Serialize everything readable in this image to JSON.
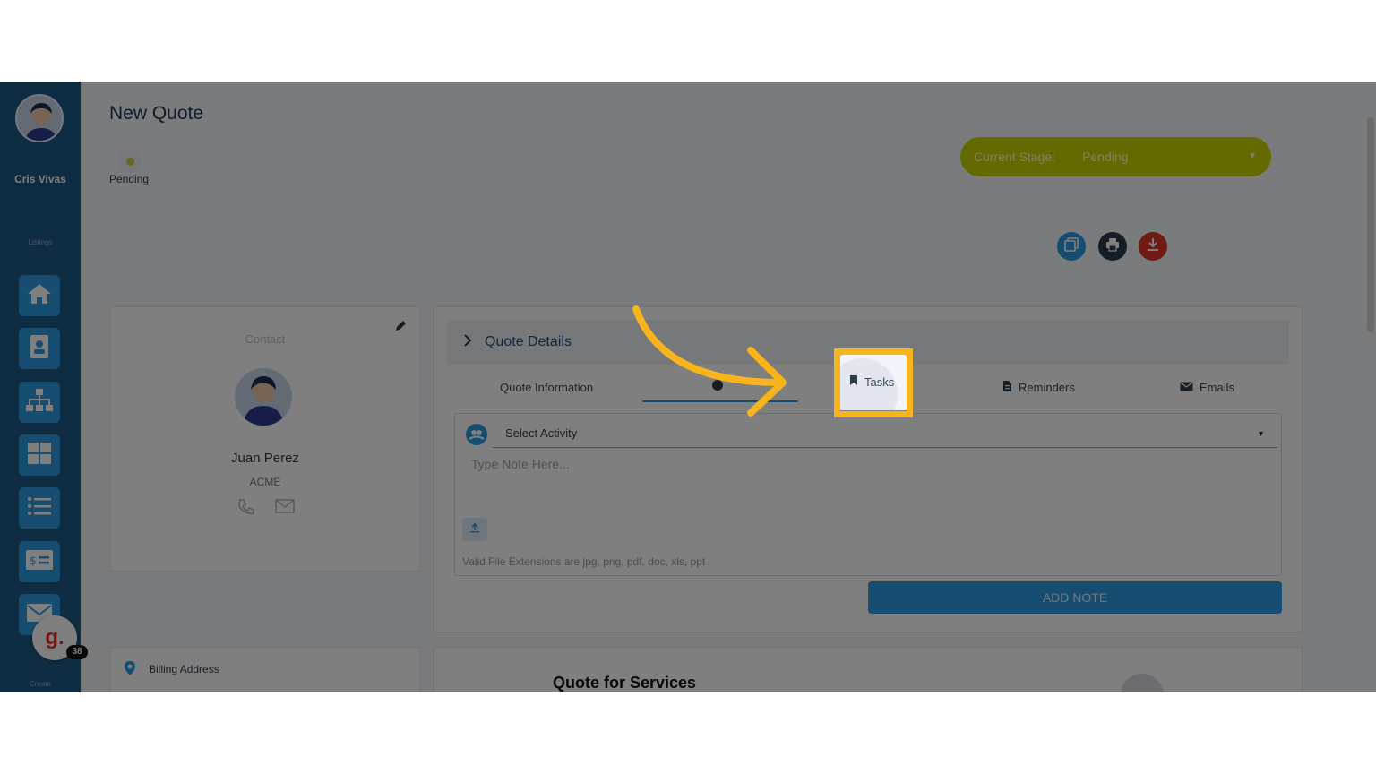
{
  "sidebar": {
    "user_name": "Cris Vivas",
    "section_listings": "Listings",
    "section_create": "Create",
    "nav_icons": [
      "home-icon",
      "contact-card-icon",
      "org-chart-icon",
      "grid-icon",
      "list-icon",
      "invoice-icon",
      "mail-icon"
    ],
    "assistant_letter": "g.",
    "assistant_count": "38"
  },
  "header": {
    "title": "New Quote",
    "stage_step_label": "Pending",
    "current_stage_label": "Current Stage:",
    "current_stage_value": "Pending"
  },
  "actions": {
    "copy_icon": "copy-icon",
    "print_icon": "print-icon",
    "download_icon": "download-icon"
  },
  "contact_card": {
    "label": "Contact",
    "name": "Juan Perez",
    "company": "ACME"
  },
  "billing": {
    "label": "Billing Address"
  },
  "quote_details": {
    "title": "Quote Details",
    "tabs": [
      {
        "label": "Quote Information"
      },
      {
        "label": "Tasks"
      },
      {
        "label": "Reminders"
      },
      {
        "label": "Emails"
      }
    ],
    "select_activity": "Select Activity",
    "note_placeholder": "Type Note Here...",
    "valid_extensions": "Valid File Extensions are jpg, png, pdf, doc, xls, ppt",
    "add_note": "ADD NOTE"
  },
  "services": {
    "title": "Quote for Services"
  },
  "colors": {
    "sidebar": "#1d5a86",
    "accent": "#2f9be0",
    "stage_pill": "#c8d200",
    "highlight": "#f8b41c",
    "danger": "#e1392b"
  }
}
